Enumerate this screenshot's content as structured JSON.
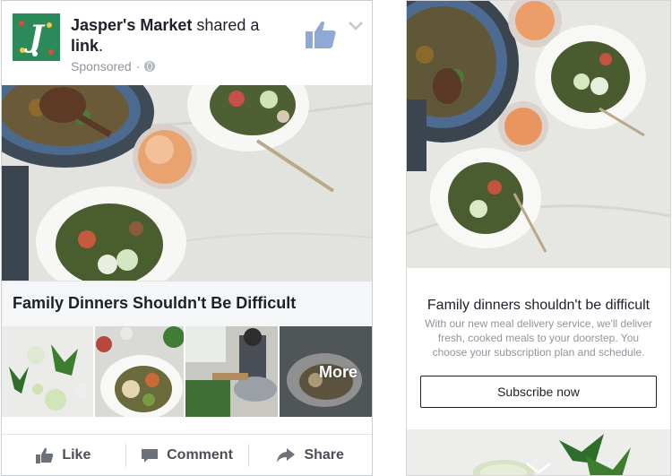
{
  "post": {
    "page_name": "Jasper's Market",
    "shared_text": "shared a",
    "link_word": "link",
    "period": ".",
    "sponsored_label": "Sponsored",
    "separator": "·",
    "ad_title": "Family Dinners Shouldn't Be Difficult",
    "carousel_more_label": "More",
    "actions": {
      "like": "Like",
      "comment": "Comment",
      "share": "Share"
    }
  },
  "canvas": {
    "title": "Family dinners shouldn't be difficult",
    "body": "With our new meal delivery service, we'll deliver fresh, cooked meals to your doorstep. You choose your subscription plan and schedule.",
    "button_label": "Subscribe now"
  },
  "colors": {
    "text_primary": "#1d2129",
    "text_secondary": "#90949c",
    "action_text": "#4b4f56",
    "avatar_green": "#2c8a5a",
    "title_bar_bg": "#f5f6f7"
  },
  "icons": [
    "thumbs-up-icon",
    "chevron-down-icon",
    "globe-icon",
    "comment-icon",
    "share-arrow-icon"
  ]
}
